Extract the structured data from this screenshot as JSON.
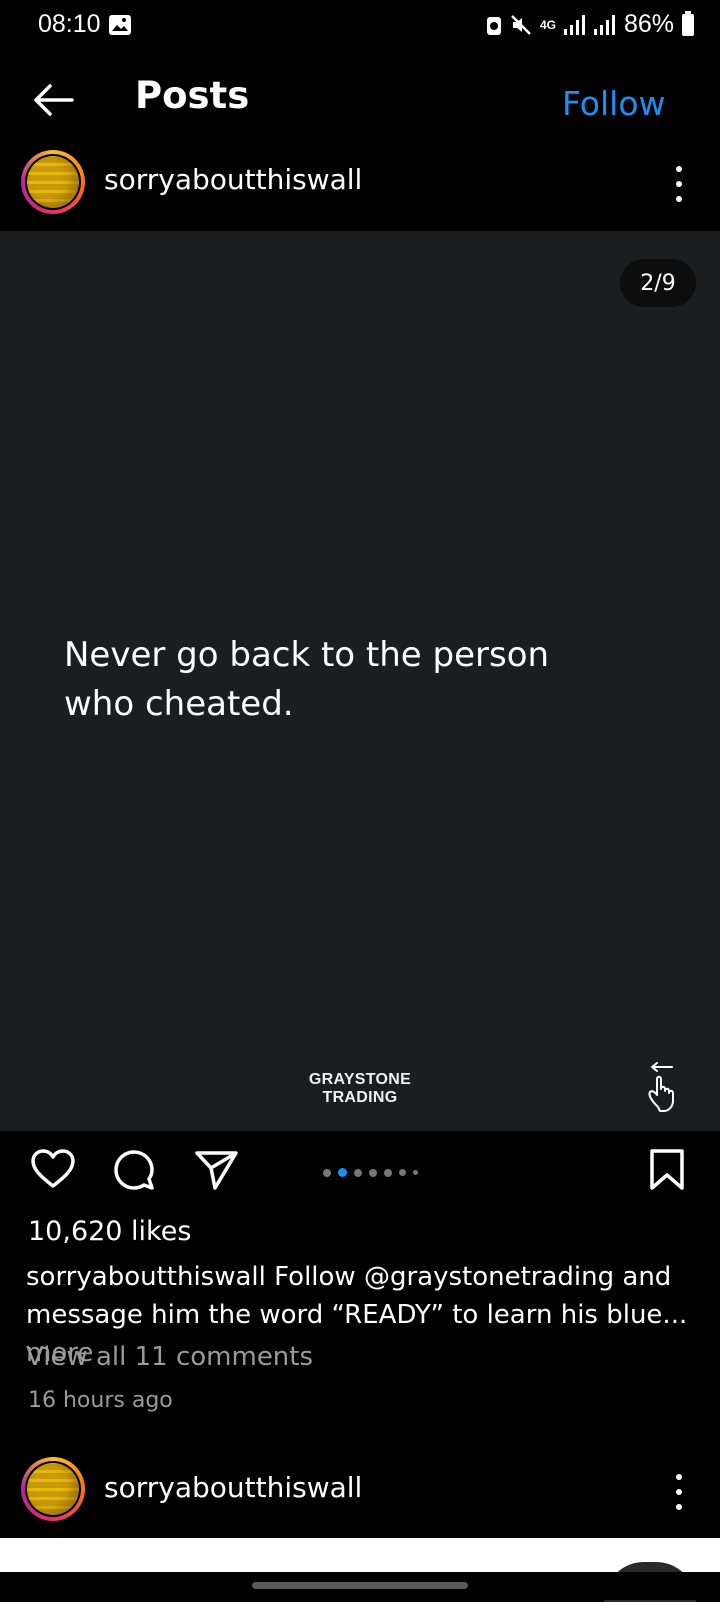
{
  "status_bar": {
    "time": "08:10",
    "network": "4G",
    "battery": "86%"
  },
  "header": {
    "title": "Posts",
    "follow_label": "Follow"
  },
  "post": {
    "author": "sorryaboutthiswall",
    "page_indicator": "2/9",
    "quote": "Never go back to the person who cheated.",
    "brand_line1": "GRAYSTONE",
    "brand_line2": "TRADING",
    "carousel": {
      "total": 9,
      "active_index": 1
    },
    "likes": "10,620 likes",
    "caption_author": "sorryaboutthiswall",
    "caption_text": "Follow @graystonetrading and message him the word “READY” to learn his blue...",
    "caption_more": "more",
    "view_comments": "View all 11 comments",
    "timestamp": "16 hours ago"
  },
  "next_post": {
    "author": "sorryaboutthiswall"
  },
  "colors": {
    "accent": "#1d8ef2",
    "post_background": "#1c1d1e",
    "muted_text": "#9a9a9a"
  }
}
